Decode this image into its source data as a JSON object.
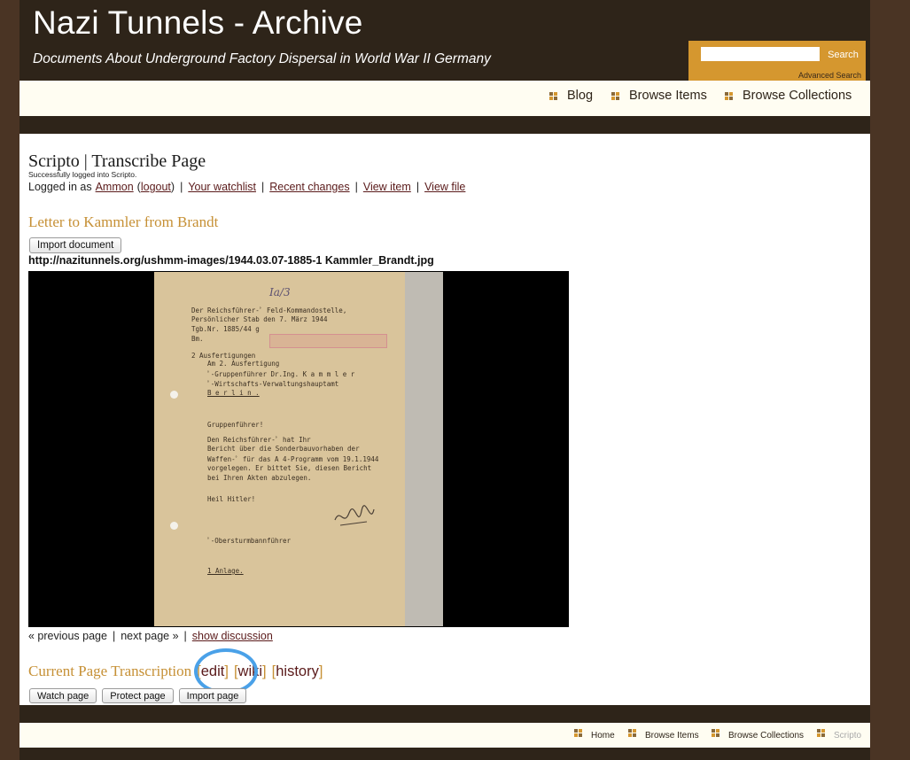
{
  "site": {
    "title": "Nazi Tunnels - Archive",
    "tagline": "Documents About Underground Factory Dispersal in World War II Germany"
  },
  "search": {
    "value": "",
    "button_label": "Search",
    "advanced_label": "Advanced Search"
  },
  "nav": {
    "items": [
      {
        "label": "Blog"
      },
      {
        "label": "Browse Items"
      },
      {
        "label": "Browse Collections"
      }
    ]
  },
  "page": {
    "heading": "Scripto | Transcribe Page",
    "login_message": "Successfully logged into Scripto.",
    "logged_in_prefix": "Logged in as",
    "username": "Ammon",
    "logout_label": "logout",
    "links": [
      "Your watchlist",
      "Recent changes",
      "View item",
      "View file"
    ]
  },
  "document": {
    "title": "Letter to Kammler from Brandt",
    "import_button": "Import document",
    "file_url": "http://nazitunnels.org/ushmm-images/1944.03.07-1885-1 Kammler_Brandt.jpg",
    "handwritten_top": "Ia/3",
    "lines": [
      "Der Reichsführer-ﾟ       Feld-Kommandostelle,",
      "Persönlicher Stab      den 7. März 1944",
      "Tgb.Nr. 1885/44 g",
      "Bm.",
      "            2 Ausfertigungen",
      "Am          2. Ausfertigung",
      "ﾟ-Gruppenführer Dr.Ing. K a m m l e r",
      "ﾟ-Wirtschafts-Verwaltungshauptamt",
      "B e r l i n .",
      "Gruppenführer!",
      "     Den Reichsführer-ﾟ hat Ihr",
      "Bericht über die Sonderbauvorhaben der",
      "Waffen-ﾟ für das A 4-Programm vom 19.1.1944",
      "vorgelegen. Er bittet Sie, diesen Bericht",
      "bei Ihren Akten abzulegen.",
      "                 Heil Hitler!",
      "                 ﾟ-Obersturmbannführer",
      "1 Anlage."
    ]
  },
  "pager": {
    "previous": "« previous page",
    "next": "next page »",
    "discussion": "show discussion"
  },
  "transcription": {
    "title": "Current Page Transcription",
    "links": [
      "edit",
      "wiki",
      "history"
    ],
    "buttons": [
      "Watch page",
      "Protect page",
      "Import page"
    ]
  },
  "footer": {
    "items": [
      {
        "label": "Home"
      },
      {
        "label": "Browse Items"
      },
      {
        "label": "Browse Collections"
      },
      {
        "label": "Scripto"
      }
    ]
  },
  "colors": {
    "header_bg": "#2e2419",
    "page_bg": "#4a3424",
    "accent_gold": "#d5972f",
    "heading_gold": "#c69035",
    "link_maroon": "#5a1a1a",
    "highlight_ring": "#4aa1e8"
  }
}
